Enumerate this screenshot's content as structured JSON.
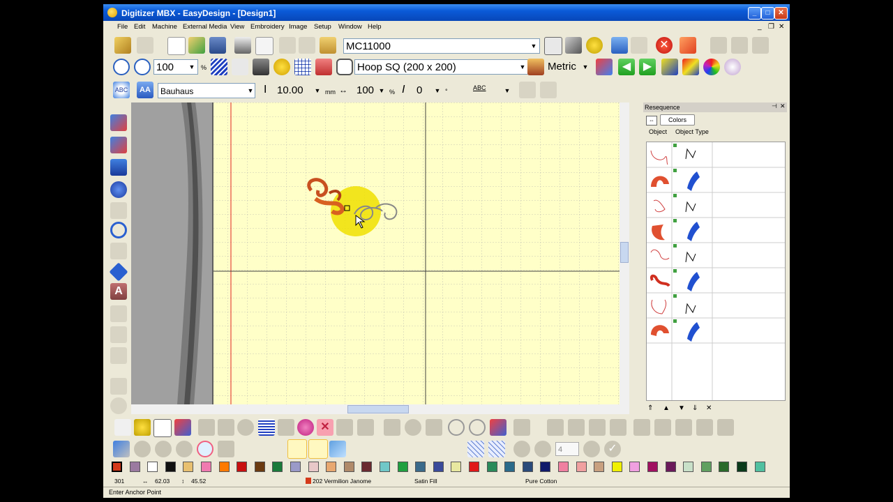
{
  "window": {
    "title": "Digitizer MBX - EasyDesign - [Design1]",
    "controls": [
      "minimize",
      "maximize",
      "close"
    ]
  },
  "menu": {
    "items": [
      "File",
      "Edit",
      "Machine",
      "External Media",
      "View",
      "Embroidery",
      "Image",
      "Setup",
      "Window",
      "Help"
    ]
  },
  "toolbar1": {
    "machine": "MC11000"
  },
  "toolbar2": {
    "zoom": "100",
    "zoom_unit": "%",
    "hoop": "Hoop SQ (200 x 200)",
    "units": "Metric"
  },
  "toolbar3": {
    "font": "Bauhaus",
    "height": "10.00",
    "height_unit": "mm",
    "width": "100",
    "width_unit": "%",
    "slant": "0",
    "slant_unit": "°",
    "text_effect": "ABC"
  },
  "resequence": {
    "title": "Resequence",
    "colors_button": "Colors",
    "col_object": "Object",
    "col_object_type": "Object Type",
    "rows": [
      {
        "object": "outline",
        "type": "running-stitch-icon"
      },
      {
        "object": "fill",
        "type": "satin-icon"
      },
      {
        "object": "outline",
        "type": "running-stitch-icon"
      },
      {
        "object": "fill",
        "type": "satin-icon"
      },
      {
        "object": "outline",
        "type": "running-stitch-icon"
      },
      {
        "object": "fill",
        "type": "satin-icon"
      },
      {
        "object": "outline",
        "type": "running-stitch-icon"
      },
      {
        "object": "fill",
        "type": "satin-icon"
      }
    ]
  },
  "palette": {
    "colors": [
      "#d43a1a",
      "#9b7aa0",
      "#ffffff",
      "#101010",
      "#e8c070",
      "#f07ab0",
      "#ff7a00",
      "#c81010",
      "#6a3a10",
      "#1a7a3a",
      "#9a9ac8",
      "#e8c8c8",
      "#e8a870",
      "#b08a6a",
      "#6a2a30",
      "#70c8c8",
      "#20a040",
      "#3a6a8a",
      "#3a4a9a",
      "#e8e8a0",
      "#e01818",
      "#2a8a5a",
      "#2a6a8a",
      "#2a4a7a",
      "#101a6a",
      "#f080a0",
      "#f0a0a0",
      "#c8a080",
      "#f0f000",
      "#f0a0e0",
      "#a01060",
      "#6a1a5a",
      "#c8e0c8",
      "#60a060",
      "#2a6a2a",
      "#0a3a1a",
      "#50c0a0"
    ]
  },
  "status": {
    "stitches": "301",
    "width": "62.03",
    "height": "45.52",
    "thread": "202 Vermilion Janome",
    "stitch_type": "Satin Fill",
    "fabric": "Pure Cotton",
    "hint": "Enter Anchor Point"
  },
  "colors": {
    "title_bar": "#0a5ad8",
    "canvas_bg": "#ffffc8",
    "hoop_line": "#e02020",
    "grid": "#c8c8c8",
    "window_bg": "#ece9d8"
  }
}
